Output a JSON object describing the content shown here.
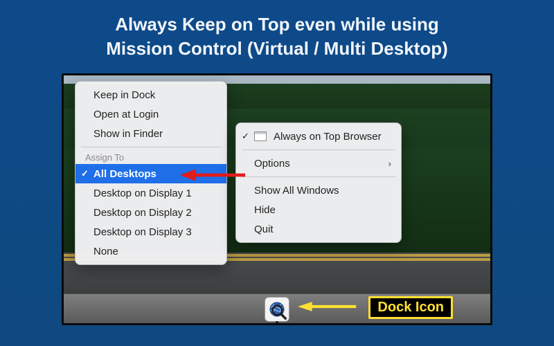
{
  "headline": {
    "line1": "Always Keep on Top even while using",
    "line2": "Mission Control (Virtual / Multi Desktop)"
  },
  "left_menu": {
    "keep_in_dock": "Keep in Dock",
    "open_at_login": "Open at Login",
    "show_in_finder": "Show in Finder",
    "assign_to_label": "Assign To",
    "all_desktops": "All Desktops",
    "display1": "Desktop on Display 1",
    "display2": "Desktop on Display 2",
    "display3": "Desktop on Display 3",
    "none": "None"
  },
  "right_menu": {
    "app_name": "Always on Top Browser",
    "options": "Options",
    "show_all": "Show All Windows",
    "hide": "Hide",
    "quit": "Quit"
  },
  "callout": {
    "dock_icon": "Dock Icon"
  },
  "colors": {
    "highlight": "#1f6fe8",
    "arrow_red": "#e21b1b",
    "arrow_yellow": "#ffe032"
  }
}
